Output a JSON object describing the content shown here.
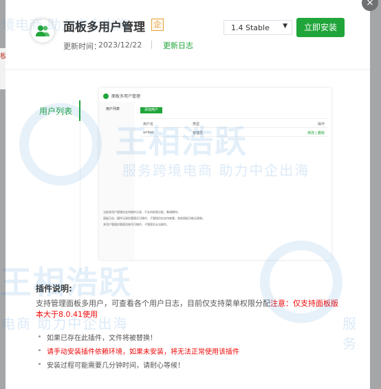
{
  "backdrop": {
    "left_snippet": "板"
  },
  "close_icon": "×",
  "header": {
    "title": "面板多用户管理",
    "badge": "企",
    "update_label": "更新时间：",
    "update_date": "2023/12/22",
    "changelog_link": "更新日志",
    "version_select": "1.4 Stable",
    "install_button": "立即安装"
  },
  "sidebar": {
    "items": [
      {
        "label": "用户列表",
        "active": true
      }
    ]
  },
  "preview": {
    "title": "面板多用户管理",
    "side_item": "用户列表",
    "add_button": "添加用户",
    "table": {
      "headers": [
        "用户名",
        "类型",
        "操作"
      ],
      "rows": [
        [
          "amber",
          "管理员",
          "修改 | 删除"
        ]
      ]
    },
    "notes": [
      "当前多用户管理仅支持操作记录，不支持权限分配，敬请期待。",
      "面板日志、操作记录仅管理员可操作，子管理员仅支持查看，其他面板功能无限制。",
      "多用户管理仅管理员账号可操作，子管理员无法操作。"
    ]
  },
  "description": {
    "heading": "插件说明:",
    "text_normal": "支持管理面板多用户，可查看各个用户日志，目前仅支持菜单权限分配",
    "text_red": "注意：仅支持面板版本大于8.0.41使用"
  },
  "bullets": [
    {
      "text": "如果已存在此插件，文件将被替换！",
      "red": false
    },
    {
      "text": "请手动安装插件依赖环境，如果未安装，将无法正常使用该插件",
      "red": true
    },
    {
      "text": "安装过程可能需要几分钟时间，请耐心等候！",
      "red": false
    }
  ],
  "watermark": {
    "brand": "王相浩跃",
    "slogan": "服务跨境电商 助力中企出海",
    "top_slogan": "境电商 助力中企出海",
    "left_slogan": "电商 助力中企出海",
    "right_slogan": "服务"
  },
  "colors": {
    "accent": "#20a53a",
    "warning": "#ef0808",
    "badge": "#e6a23c"
  }
}
